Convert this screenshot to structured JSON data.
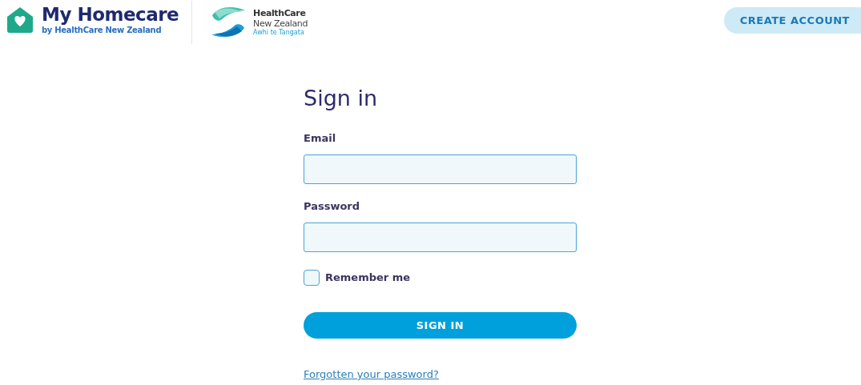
{
  "header": {
    "brand": {
      "title": "My Homecare",
      "subtitle": "by HealthCare New Zealand"
    },
    "partner": {
      "name": "HealthCare",
      "region": "New Zealand",
      "tagline": "Awhi te Tangata"
    },
    "create_account": "CREATE ACCOUNT"
  },
  "form": {
    "title": "Sign in",
    "fields": [
      {
        "label": "Email"
      },
      {
        "label": "Password"
      }
    ],
    "remember": {
      "label": "Remember me",
      "checked": false
    },
    "submit": "SIGN IN",
    "forgot_link": "Forgotten your password?"
  }
}
